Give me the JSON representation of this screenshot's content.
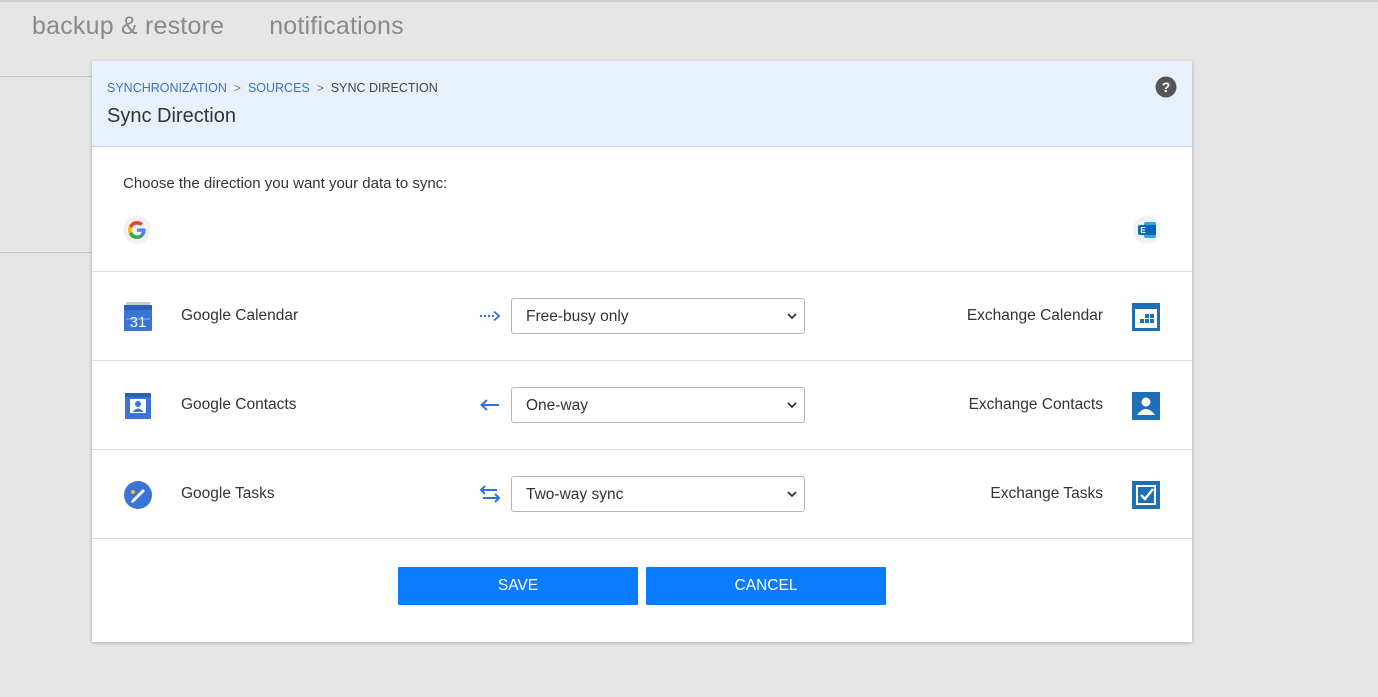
{
  "background": {
    "tabs": [
      "backup & restore",
      "notifications"
    ]
  },
  "dialog": {
    "breadcrumb": {
      "items": [
        "SYNCHRONIZATION",
        "SOURCES"
      ],
      "separator": ">",
      "current": "SYNC DIRECTION"
    },
    "title": "Sync Direction",
    "intro": "Choose the direction you want your data to sync:",
    "rows": [
      {
        "source": "Google Calendar",
        "source_icon": "google-calendar-icon",
        "direction_icon": "dotted-arrow-right-icon",
        "selected": "Free-busy only",
        "destination": "Exchange Calendar",
        "destination_icon": "exchange-calendar-icon"
      },
      {
        "source": "Google Contacts",
        "source_icon": "google-contacts-icon",
        "direction_icon": "arrow-left-icon",
        "selected": "One-way",
        "destination": "Exchange Contacts",
        "destination_icon": "exchange-contacts-icon"
      },
      {
        "source": "Google Tasks",
        "source_icon": "google-tasks-icon",
        "direction_icon": "two-way-arrows-icon",
        "selected": "Two-way sync",
        "destination": "Exchange Tasks",
        "destination_icon": "exchange-tasks-icon"
      }
    ],
    "save_label": "SAVE",
    "cancel_label": "CANCEL"
  },
  "colors": {
    "accent": "#0a7cff",
    "link": "#3c74c4",
    "header_bg": "#e8f0fb",
    "exchange_blue": "#1f6fb5"
  }
}
